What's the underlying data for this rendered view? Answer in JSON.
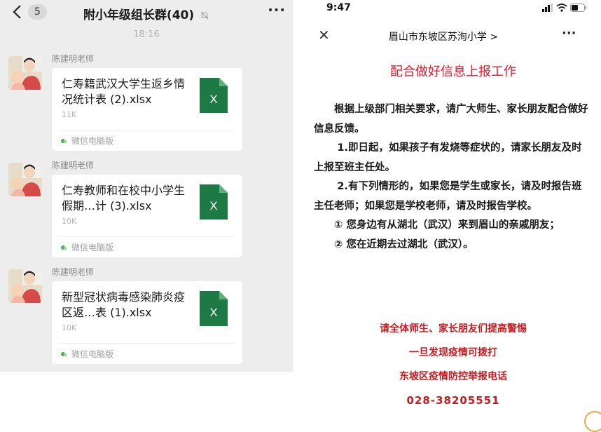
{
  "chat": {
    "back_count": "5",
    "title": "附小年级组长群(40)",
    "more": "···",
    "timestamp": "18:16",
    "messages": [
      {
        "sender": "陈建明老师",
        "file_title": "仁寿籍武汉大学生返乡情况统计表 (2).xlsx",
        "file_size": "11K",
        "source": "微信电脑版"
      },
      {
        "sender": "陈建明老师",
        "file_title": "仁寿教师和在校中小学生假期…计 (3).xlsx",
        "file_size": "10K",
        "source": "微信电脑版"
      },
      {
        "sender": "陈建明老师",
        "file_title": "新型冠状病毒感染肺炎疫区返…表 (1).xlsx",
        "file_size": "10K",
        "source": "微信电脑版"
      }
    ],
    "file_icon_letter": "X",
    "colors": {
      "excel_green": "#1e7a45",
      "chat_bg": "#ededed"
    }
  },
  "article": {
    "status_time": "9:47",
    "close": "✕",
    "account_name": "眉山市东坡区苏洵小学 >",
    "more": "···",
    "title": "配合做好信息上报工作",
    "paragraphs": [
      "根据上级部门相关要求，请广大师生、家长朋友配合做好信息反馈。",
      "1.即日起，如果孩子有发烧等症状的，请家长朋友及时上报至班主任处。",
      "2.有下列情形的，如果您是学生或家长，请及时报告班主任老师；如果您是学校老师，请及时报告学校。",
      "① 您身边有从湖北（武汉）来到眉山的亲戚朋友；",
      "② 您在近期去过湖北（武汉）。"
    ],
    "footer": [
      "请全体师生、家长朋友们提高警惕",
      "一旦发现疫情可拨打",
      "东坡区疫情防控举报电话",
      "028-38205551"
    ],
    "colors": {
      "title_red": "#e0192b",
      "footer_red": "#c91a1f"
    }
  }
}
